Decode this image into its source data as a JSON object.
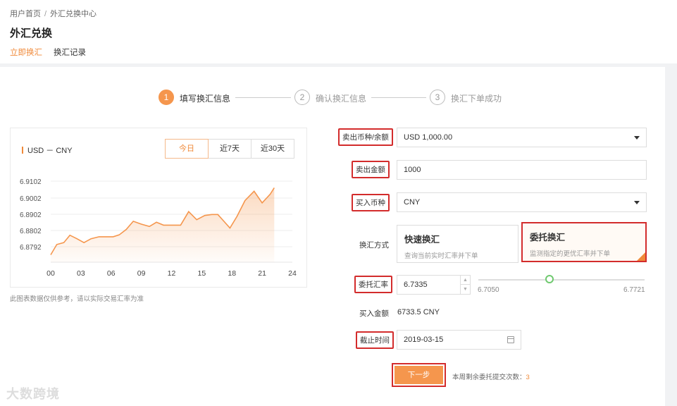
{
  "breadcrumb": {
    "home": "用户首页",
    "sep": "/",
    "current": "外汇兑换中心"
  },
  "page_title": "外汇兑换",
  "tabs": [
    {
      "label": "立即换汇"
    },
    {
      "label": "换汇记录"
    }
  ],
  "steps": [
    {
      "num": "1",
      "label": "填写换汇信息"
    },
    {
      "num": "2",
      "label": "确认换汇信息"
    },
    {
      "num": "3",
      "label": "换汇下单成功"
    }
  ],
  "chart_data": {
    "type": "area",
    "title": "USD － CNY",
    "x": [
      0,
      0.6,
      1.3,
      1.9,
      2.6,
      3.3,
      4.0,
      4.8,
      5.6,
      6.2,
      6.8,
      7.5,
      8.2,
      9.0,
      9.8,
      10.5,
      11.2,
      12.0,
      12.9,
      13.7,
      14.5,
      15.3,
      16.0,
      16.6,
      17.2,
      17.8,
      18.5,
      19.3,
      20.2,
      21.0,
      21.8,
      22.2
    ],
    "y": [
      6.8722,
      6.8775,
      6.8785,
      6.8823,
      6.8805,
      6.8785,
      6.8805,
      6.8815,
      6.8815,
      6.8815,
      6.8825,
      6.8853,
      6.8895,
      6.888,
      6.8868,
      6.889,
      6.8875,
      6.8875,
      6.8875,
      6.8945,
      6.8903,
      6.8925,
      6.893,
      6.893,
      6.8895,
      6.886,
      6.892,
      6.9002,
      6.905,
      6.899,
      6.9035,
      6.9068
    ],
    "xticks": [
      "00",
      "03",
      "06",
      "09",
      "12",
      "15",
      "18",
      "21",
      "24"
    ],
    "yticks": [
      "6.9102",
      "6.9002",
      "6.8902",
      "6.8802",
      "6.8792"
    ],
    "xlim": [
      0,
      24
    ],
    "grid": true,
    "color": "#f5964d"
  },
  "chart": {
    "pair_label": "USD － CNY",
    "ranges": [
      {
        "label": "今日"
      },
      {
        "label": "近7天"
      },
      {
        "label": "近30天"
      }
    ],
    "disclaimer": "此图表数据仅供参考，请以实际交易汇率为准"
  },
  "form": {
    "sell_currency_label": "卖出币种/余额",
    "sell_currency_value": "USD 1,000.00",
    "sell_amount_label": "卖出金额",
    "sell_amount_value": "1000",
    "buy_currency_label": "买入币种",
    "buy_currency_value": "CNY",
    "method_label": "换汇方式",
    "methods": [
      {
        "title": "快速换汇",
        "desc": "查询当前实时汇率并下单"
      },
      {
        "title": "委托换汇",
        "desc": "监测指定的更优汇率并下单"
      }
    ],
    "rate_label": "委托汇率",
    "rate_value": "6.7335",
    "stepper_up": "▲",
    "stepper_down": "▼",
    "slider_min": "6.7050",
    "slider_max": "6.7721",
    "slider_level": 0.43,
    "buy_amount_label": "买入金额",
    "buy_amount_value": "6733.5 CNY",
    "deadline_label": "截止时间",
    "deadline_value": "2019-03-15",
    "next_label": "下一步",
    "remaining_text": "本周剩余委托提交次数：",
    "remaining_count": "3"
  },
  "watermark": "大数跨境",
  "colors": {
    "accent": "#f08a3a",
    "highlight": "#d32c2c"
  }
}
